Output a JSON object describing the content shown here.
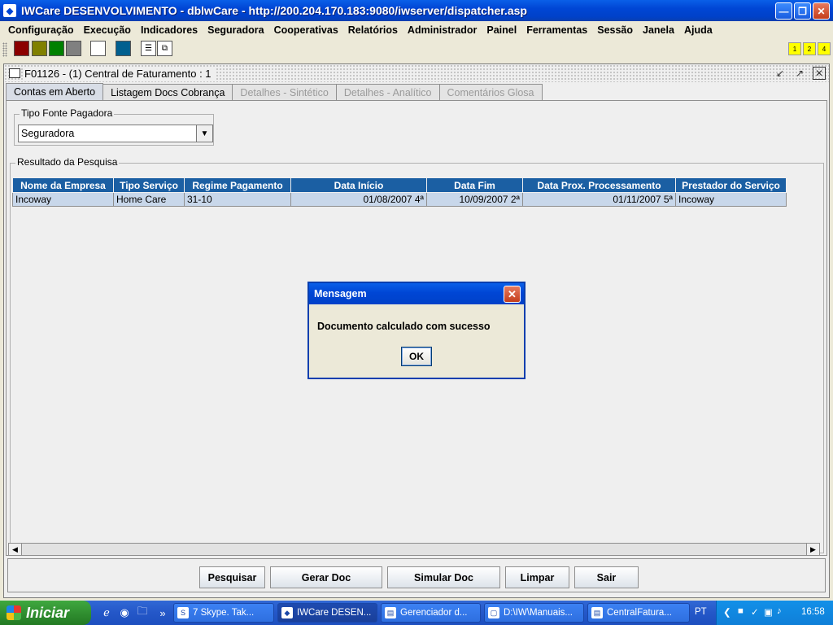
{
  "window": {
    "title": "IWCare DESENVOLVIMENTO - dblwCare - http://200.204.170.183:9080/iwserver/dispatcher.asp"
  },
  "menu": [
    "Configuração",
    "Execução",
    "Indicadores",
    "Seguradora",
    "Cooperativas",
    "Relatórios",
    "Administrador",
    "Painel",
    "Ferramentas",
    "Sessão",
    "Janela",
    "Ajuda"
  ],
  "toolbar": {
    "swatches": [
      "#8B0000",
      "#808000",
      "#008000",
      "#808080",
      "#FFFFFF",
      "#005F8F"
    ],
    "workspaces": [
      "1",
      "2",
      "4"
    ]
  },
  "frame": {
    "title": "F01126 - (1) Central de Faturamento : 1"
  },
  "tabs": [
    {
      "label": "Contas em Aberto",
      "state": "active"
    },
    {
      "label": "Listagem Docs Cobrança",
      "state": "enabled"
    },
    {
      "label": "Detalhes - Sintético",
      "state": "disabled"
    },
    {
      "label": "Detalhes - Analítico",
      "state": "disabled"
    },
    {
      "label": "Comentários Glosa",
      "state": "disabled"
    }
  ],
  "filter": {
    "legend": "Tipo Fonte Pagadora",
    "value": "Seguradora"
  },
  "results": {
    "legend": "Resultado da Pesquisa",
    "columns": [
      "Nome da Empresa",
      "Tipo Serviço",
      "Regime Pagamento",
      "Data Início",
      "Data Fim",
      "Data Prox. Processamento",
      "Prestador do Serviço"
    ],
    "rows": [
      [
        "Incoway",
        "Home Care",
        "31-10",
        "01/08/2007 4ª",
        "10/09/2007 2ª",
        "01/11/2007 5ª",
        "Incoway"
      ]
    ]
  },
  "buttons": {
    "pesquisar": "Pesquisar",
    "gerar": "Gerar Doc",
    "simular": "Simular Doc",
    "limpar": "Limpar",
    "sair": "Sair"
  },
  "dialog": {
    "title": "Mensagem",
    "message": "Documento calculado com sucesso",
    "ok": "OK"
  },
  "taskbar": {
    "start": "Iniciar",
    "tasks": [
      {
        "label": "7 Skype. Tak...",
        "active": false
      },
      {
        "label": "IWCare DESEN...",
        "active": true
      },
      {
        "label": "Gerenciador d...",
        "active": false
      },
      {
        "label": "D:\\IW\\Manuais...",
        "active": false
      },
      {
        "label": "CentralFatura...",
        "active": false
      }
    ],
    "language": "PT",
    "clock": "16:58"
  }
}
